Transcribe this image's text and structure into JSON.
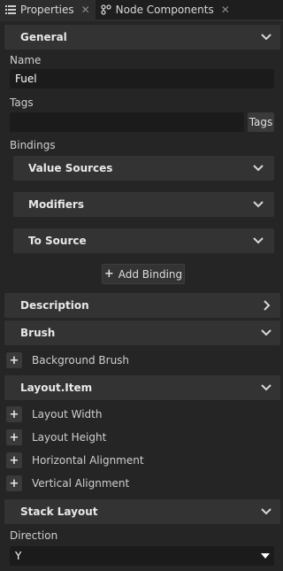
{
  "tabs": [
    {
      "label": "Properties",
      "icon": "list-icon",
      "active": true
    },
    {
      "label": "Node Components",
      "icon": "node-components-icon",
      "active": false
    }
  ],
  "general": {
    "title": "General",
    "name_label": "Name",
    "name_value": "Fuel",
    "tags_label": "Tags",
    "tags_value": "",
    "tags_button": "Tags",
    "bindings_label": "Bindings",
    "bindings": [
      {
        "label": "Value Sources"
      },
      {
        "label": "Modifiers"
      },
      {
        "label": "To Source"
      }
    ],
    "add_binding": "Add Binding"
  },
  "description": {
    "title": "Description"
  },
  "brush": {
    "title": "Brush",
    "items": [
      "Background Brush"
    ]
  },
  "layout_item": {
    "title": "Layout.Item",
    "items": [
      "Layout Width",
      "Layout Height",
      "Horizontal Alignment",
      "Vertical Alignment"
    ]
  },
  "stack_layout": {
    "title": "Stack Layout",
    "direction_label": "Direction",
    "direction_value": "Y"
  }
}
